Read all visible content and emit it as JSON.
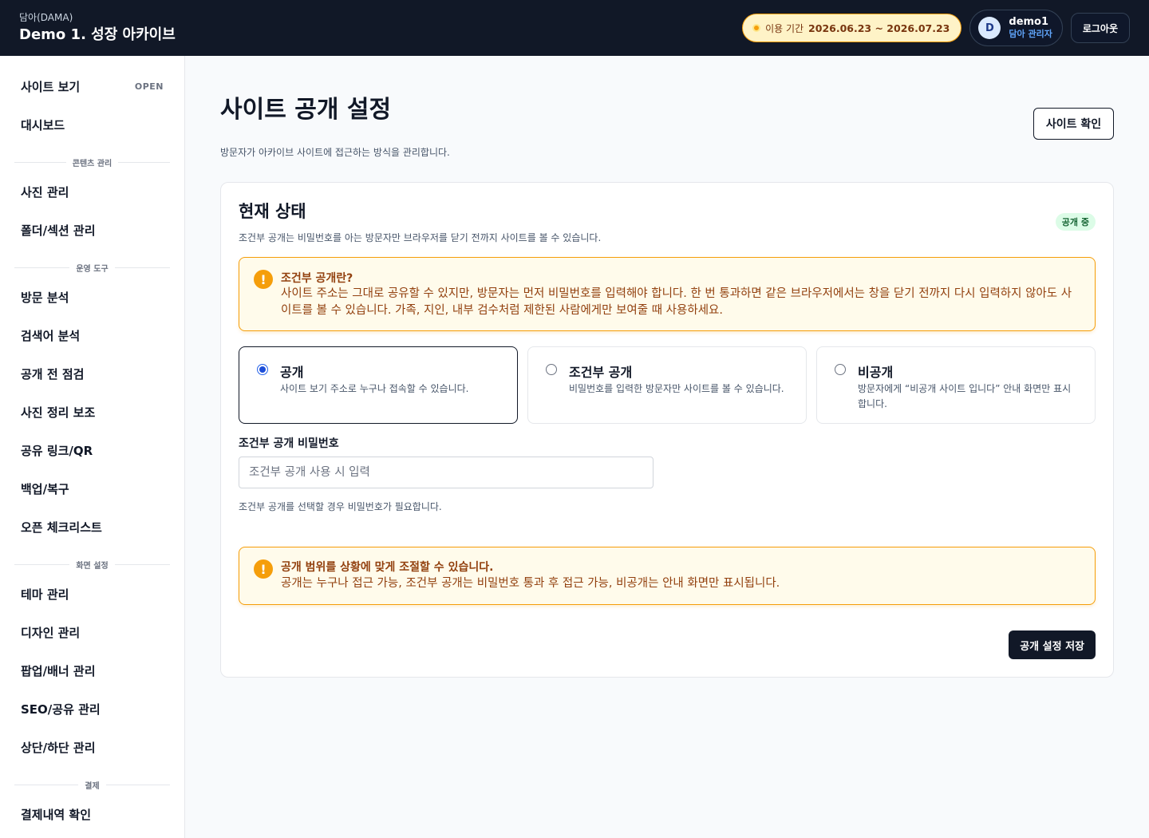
{
  "header": {
    "brand_small": "담아(DAMA)",
    "brand_title": "Demo 1. 성장 아카이브",
    "period_label": "이용 기간",
    "period_value": "2026.06.23 ~ 2026.07.23",
    "user_initial": "D",
    "user_name": "demo1",
    "user_role": "담아 관리자",
    "logout_label": "로그아웃"
  },
  "sidebar": {
    "site_view": "사이트 보기",
    "site_view_badge": "OPEN",
    "dashboard": "대시보드",
    "section_content": "콘텐츠 관리",
    "photo_manage": "사진 관리",
    "folder_manage": "폴더/섹션 관리",
    "section_ops": "운영 도구",
    "visit_analysis": "방문 분석",
    "search_analysis": "검색어 분석",
    "prepublish_check": "공개 전 점검",
    "photo_assist": "사진 정리 보조",
    "share_link": "공유 링크/QR",
    "backup": "백업/복구",
    "open_checklist": "오픈 체크리스트",
    "section_display": "화면 설정",
    "theme_manage": "테마 관리",
    "design_manage": "디자인 관리",
    "popup_manage": "팝업/배너 관리",
    "seo_manage": "SEO/공유 관리",
    "header_footer": "상단/하단 관리",
    "section_billing": "결제",
    "billing_history": "결제내역 확인"
  },
  "main": {
    "title": "사이트 공개 설정",
    "subtitle": "방문자가 아카이브 사이트에 접근하는 방식을 관리합니다.",
    "site_check_label": "사이트 확인",
    "card": {
      "title": "현재 상태",
      "subtitle": "조건부 공개는 비밀번호를 아는 방문자만 브라우저를 닫기 전까지 사이트를 볼 수 있습니다.",
      "status_badge": "공개 중",
      "notice1_title": "조건부 공개란?",
      "notice1_body": "사이트 주소는 그대로 공유할 수 있지만, 방문자는 먼저 비밀번호를 입력해야 합니다. 한 번 통과하면 같은 브라우저에서는 창을 닫기 전까지 다시 입력하지 않아도 사이트를 볼 수 있습니다. 가족, 지인, 내부 검수처럼 제한된 사람에게만 보여줄 때 사용하세요.",
      "options": [
        {
          "title": "공개",
          "desc": "사이트 보기 주소로 누구나 접속할 수 있습니다.",
          "selected": true
        },
        {
          "title": "조건부 공개",
          "desc": "비밀번호를 입력한 방문자만 사이트를 볼 수 있습니다.",
          "selected": false
        },
        {
          "title": "비공개",
          "desc": "방문자에게 “비공개 사이트 입니다” 안내 화면만 표시합니다.",
          "selected": false
        }
      ],
      "password_label": "조건부 공개 비밀번호",
      "password_placeholder": "조건부 공개 사용 시 입력",
      "password_value": "",
      "password_help": "조건부 공개를 선택할 경우 비밀번호가 필요합니다.",
      "notice2_title": "공개 범위를 상황에 맞게 조절할 수 있습니다.",
      "notice2_body": "공개는 누구나 접근 가능, 조건부 공개는 비밀번호 통과 후 접근 가능, 비공개는 안내 화면만 표시됩니다.",
      "save_label": "공개 설정 저장"
    }
  },
  "colors": {
    "header_bg": "#111827",
    "accent_amber": "#f59e0b",
    "notice_bg": "#fffbeb",
    "notice_text": "#92400e",
    "badge_bg": "#dcfce7",
    "badge_text": "#166534",
    "radio_blue": "#1d4ed8"
  },
  "icons": {
    "notice": "exclamation-icon",
    "period": "dot-icon"
  }
}
